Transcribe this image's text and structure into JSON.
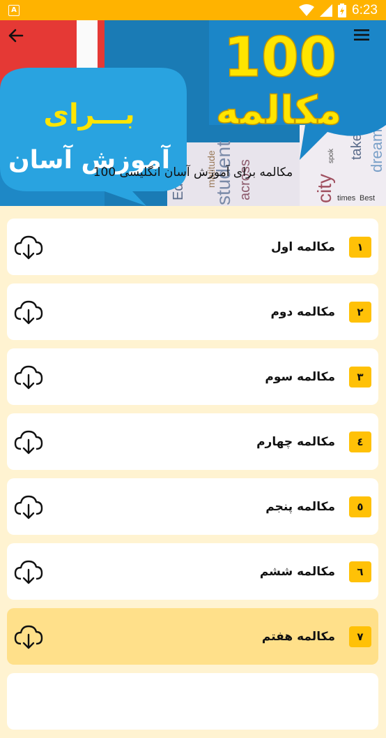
{
  "status_bar": {
    "notification_icon": "A",
    "time": "6:23",
    "icons": [
      "wifi-icon",
      "signal-icon",
      "battery-charging-icon"
    ]
  },
  "header": {
    "back_icon": "arrow-left-icon",
    "menu_icon": "hamburger-menu-icon",
    "banner": {
      "big_number": "100",
      "big_word": "مکالمه",
      "bubble_line1": "بـــرای",
      "bubble_line2": "آموزش آسان",
      "collage_words": [
        "Education",
        "student",
        "across",
        "take",
        "dreams",
        "times",
        "Best",
        "city",
        "spok",
        "matitude"
      ]
    },
    "caption": "مکالمه برای آموزش آسان انگلیسی 100"
  },
  "conversations": [
    {
      "number": "١",
      "title": "مکالمه اول",
      "highlighted": false
    },
    {
      "number": "٢",
      "title": "مکالمه دوم",
      "highlighted": false
    },
    {
      "number": "٣",
      "title": "مکالمه سوم",
      "highlighted": false
    },
    {
      "number": "٤",
      "title": "مکالمه چهارم",
      "highlighted": false
    },
    {
      "number": "٥",
      "title": "مکالمه پنجم",
      "highlighted": false
    },
    {
      "number": "٦",
      "title": "مکالمه ششم",
      "highlighted": false
    },
    {
      "number": "٧",
      "title": "مکالمه هفتم",
      "highlighted": true
    },
    {
      "number": "",
      "title": "",
      "highlighted": false
    }
  ],
  "colors": {
    "accent": "#FFB300",
    "badge": "#FFC107",
    "list_background": "#FFF3D1",
    "highlight": "#FFE08A",
    "banner_blue": "#1976a8",
    "banner_yellow": "#FFE500"
  }
}
